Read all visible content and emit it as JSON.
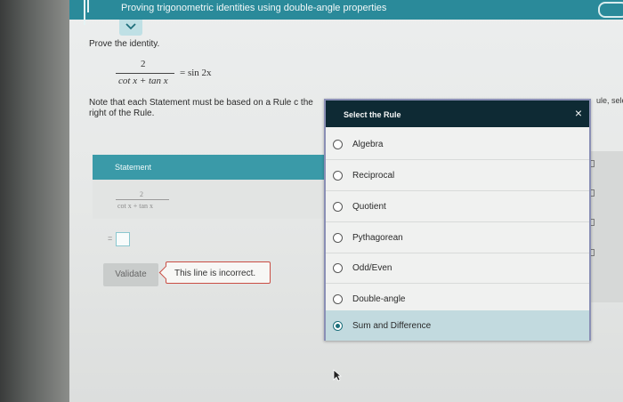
{
  "header": {
    "title": "Proving trigonometric identities using double-angle properties"
  },
  "problem": {
    "prompt": "Prove the identity.",
    "numerator": "2",
    "denominator": "cot x + tan x",
    "rhs": "= sin 2x",
    "note": "Note that each Statement must be based on a Rule c the right of the Rule.",
    "right_clip": "ule, sele"
  },
  "statement": {
    "header": "Statement",
    "numerator": "2",
    "denominator": "cot x + tan x",
    "equals": "=",
    "validate_label": "Validate",
    "error_message": "This line is incorrect."
  },
  "rule_dialog": {
    "title": "Select the Rule",
    "close": "×",
    "options": [
      {
        "label": "Algebra",
        "selected": false
      },
      {
        "label": "Reciprocal",
        "selected": false
      },
      {
        "label": "Quotient",
        "selected": false
      },
      {
        "label": "Pythagorean",
        "selected": false
      },
      {
        "label": "Odd/Even",
        "selected": false
      },
      {
        "label": "Double-angle",
        "selected": false
      },
      {
        "label": "Sum and Difference",
        "selected": true
      }
    ]
  },
  "colors": {
    "topbar": "#2a8a9a",
    "dialog_header": "#0e2a34",
    "error_border": "#c94d43",
    "selected_row": "#c2dadf"
  }
}
